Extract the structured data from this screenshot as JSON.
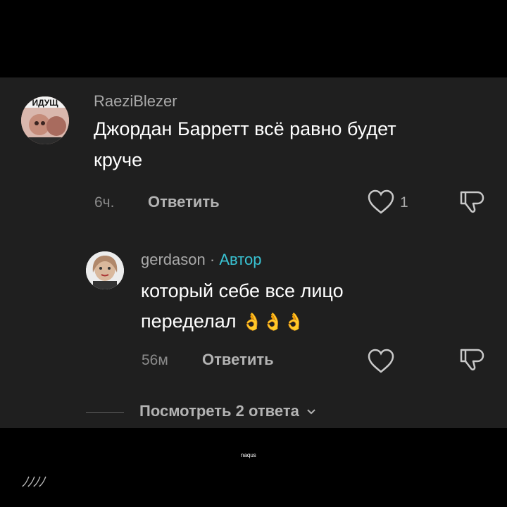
{
  "comments": [
    {
      "username": "RaeziBlezer",
      "text_line1": "Джордан Барретт всё равно будет",
      "text_line2": "круче",
      "time": "6ч.",
      "reply_label": "Ответить",
      "likes": "1",
      "avatar_text": "ИДУЩ"
    },
    {
      "username": "gerdason",
      "separator": "·",
      "author_badge": "Автор",
      "text_line1": "который себе все лицо",
      "text_line2": "переделал",
      "emoji": "👌👌👌",
      "time": "56м",
      "reply_label": "Ответить"
    }
  ],
  "view_replies": "Посмотреть 2 ответа",
  "watermark": "naqus",
  "colors": {
    "panel": "#1f1f1f",
    "author": "#39c3d3",
    "muted": "#8b8b8b"
  }
}
